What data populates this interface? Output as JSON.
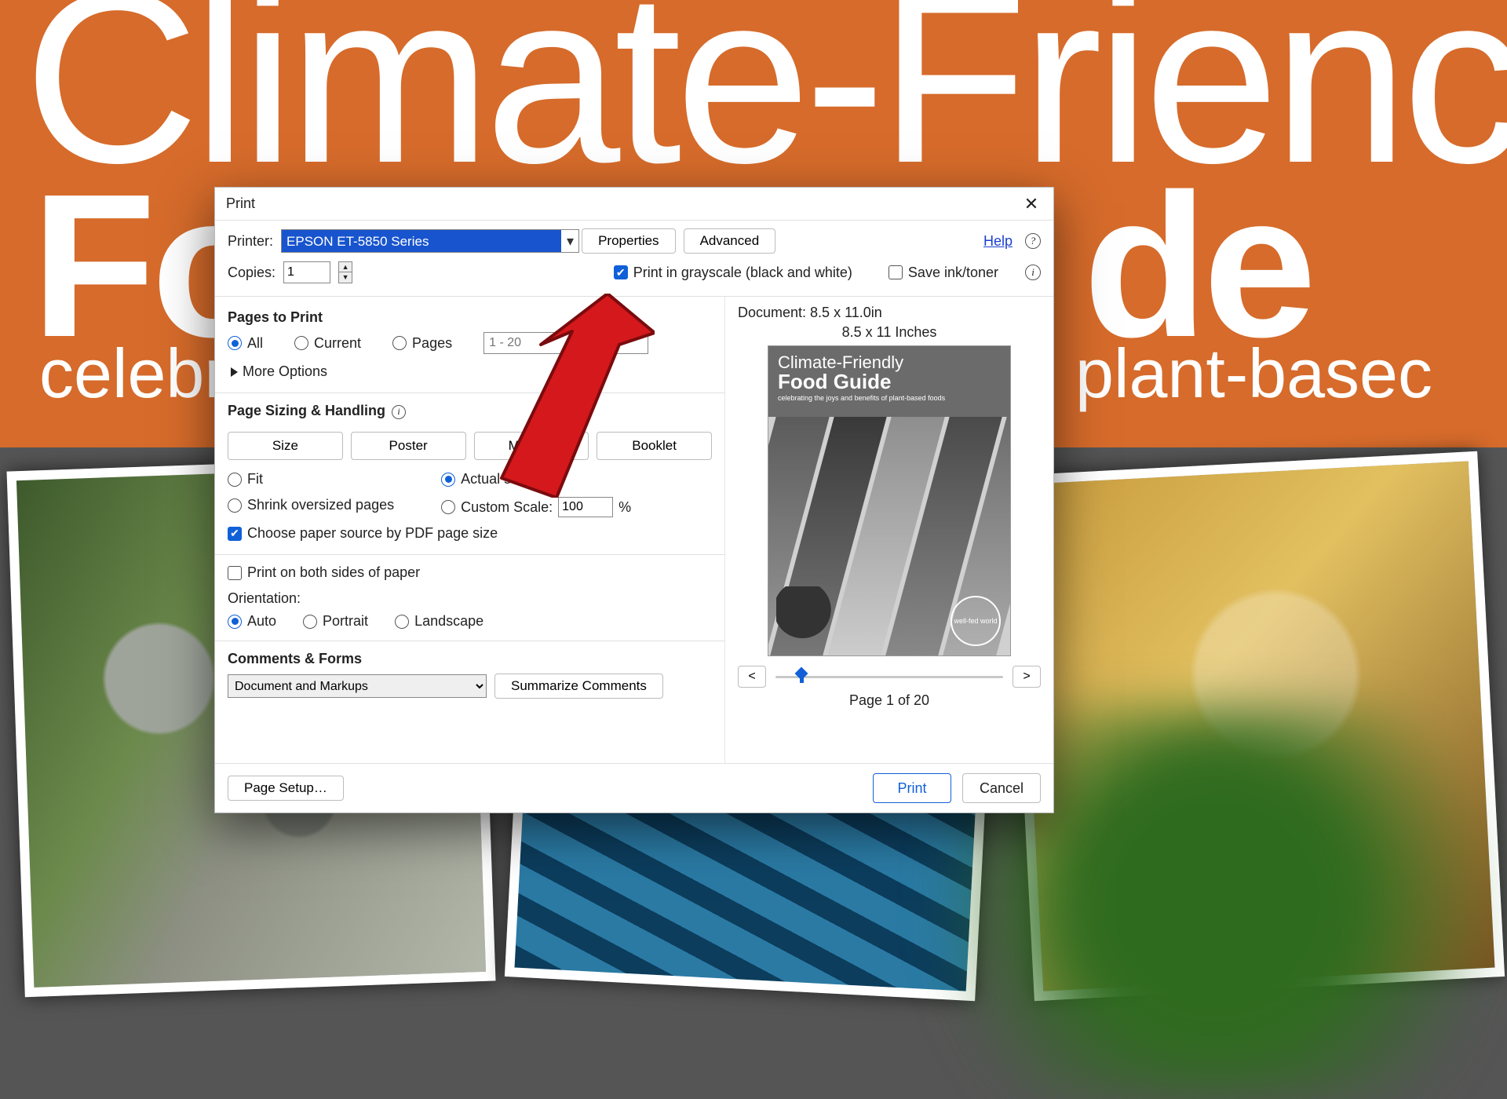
{
  "background": {
    "title_thin": "Climate-Frienc",
    "title_bold": "Fo",
    "subtitle_left": "celebr",
    "subtitle_right": "plant-basec",
    "title_bold_right": "de"
  },
  "dialog": {
    "title": "Print",
    "printer_label": "Printer:",
    "printer_selected": "EPSON ET-5850 Series",
    "properties_btn": "Properties",
    "advanced_btn": "Advanced",
    "help_link": "Help",
    "copies_label": "Copies:",
    "copies_value": "1",
    "grayscale_label": "Print in grayscale (black and white)",
    "save_ink_label": "Save ink/toner",
    "pages": {
      "heading": "Pages to Print",
      "all": "All",
      "current": "Current",
      "pages": "Pages",
      "range_placeholder": "1 - 20",
      "more_options": "More Options"
    },
    "sizing": {
      "heading": "Page Sizing & Handling",
      "tabs": {
        "size": "Size",
        "poster": "Poster",
        "multiple": "Multiple",
        "booklet": "Booklet"
      },
      "fit": "Fit",
      "actual": "Actual size",
      "shrink": "Shrink oversized pages",
      "custom": "Custom Scale:",
      "custom_value": "100",
      "percent": "%",
      "choose_source": "Choose paper source by PDF page size"
    },
    "duplex_label": "Print on both sides of paper",
    "orientation": {
      "heading": "Orientation:",
      "auto": "Auto",
      "portrait": "Portrait",
      "landscape": "Landscape"
    },
    "comments": {
      "heading": "Comments & Forms",
      "selected": "Document and Markups",
      "summarize_btn": "Summarize Comments"
    },
    "preview": {
      "doc_dim": "Document: 8.5 x 11.0in",
      "page_dim": "8.5 x 11 Inches",
      "cover_t1": "Climate-Friendly",
      "cover_t2": "Food Guide",
      "cover_t3": "celebrating the joys and benefits of plant-based foods",
      "logo_text": "well-fed world",
      "page_indic": "Page 1 of 20",
      "prev": "<",
      "next": ">"
    },
    "footer": {
      "page_setup": "Page Setup…",
      "print": "Print",
      "cancel": "Cancel"
    }
  }
}
